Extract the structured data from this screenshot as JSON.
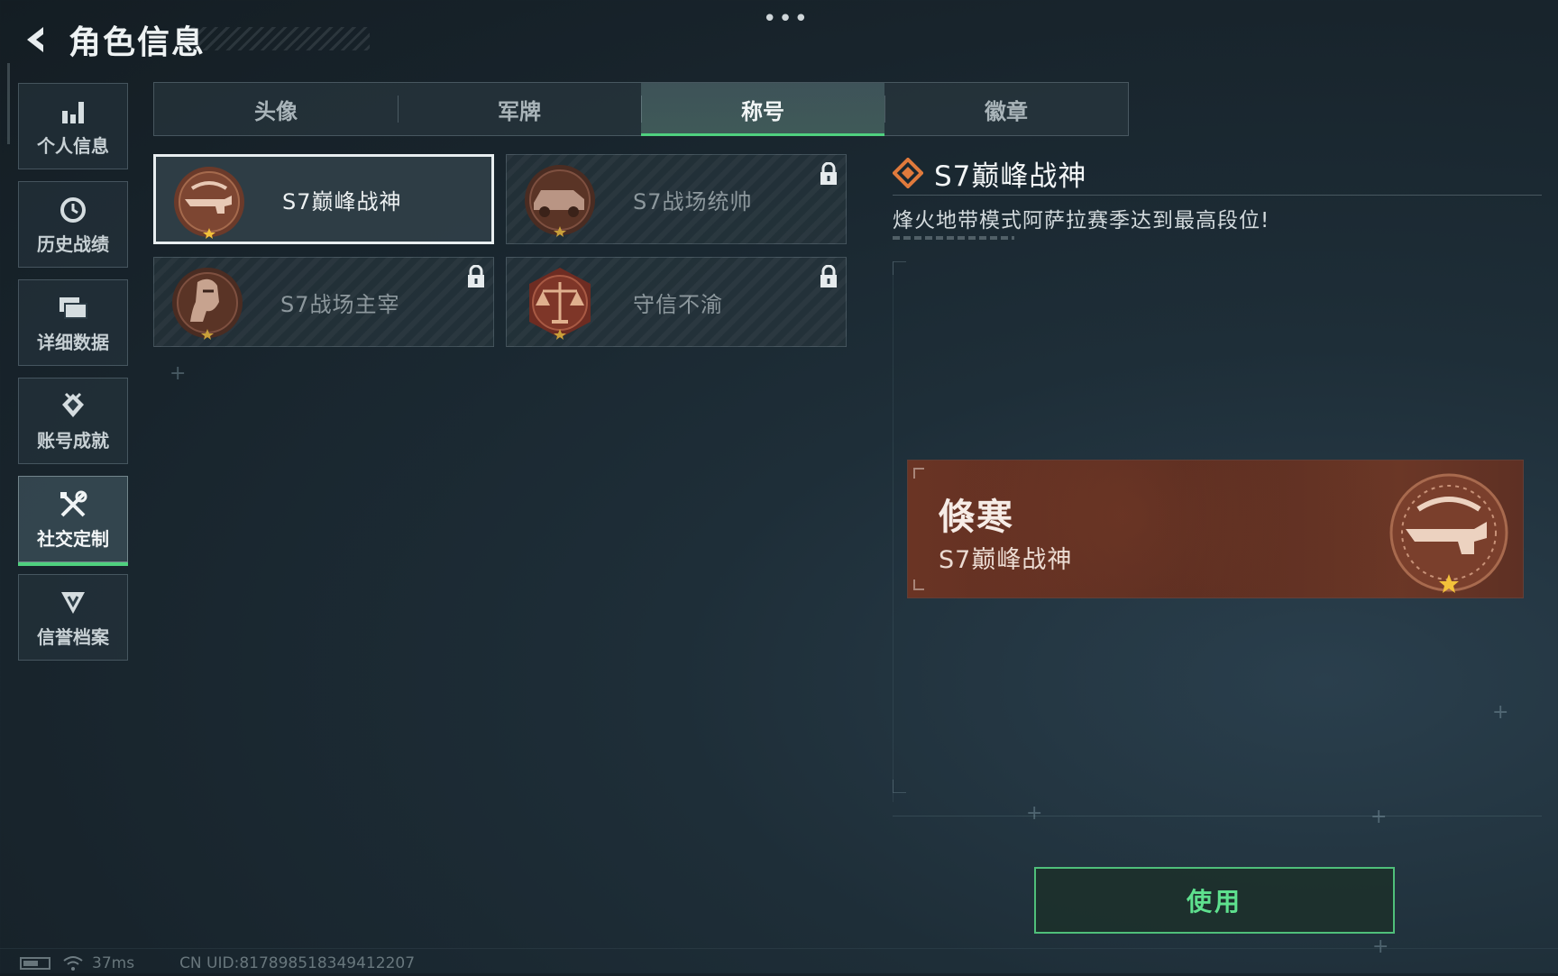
{
  "header": {
    "title": "角色信息",
    "more": "•••"
  },
  "sidebar": {
    "items": [
      {
        "label": "个人信息",
        "icon": "bar-chart-icon"
      },
      {
        "label": "历史战绩",
        "icon": "history-clock-icon"
      },
      {
        "label": "详细数据",
        "icon": "data-cards-icon"
      },
      {
        "label": "账号成就",
        "icon": "achievement-medal-icon"
      },
      {
        "label": "社交定制",
        "icon": "tools-cross-icon",
        "active": true
      },
      {
        "label": "信誉档案",
        "icon": "reputation-shield-icon"
      }
    ]
  },
  "tabs": [
    {
      "label": "头像"
    },
    {
      "label": "军牌"
    },
    {
      "label": "称号",
      "active": true
    },
    {
      "label": "徽章"
    }
  ],
  "titles": [
    {
      "label": "S7巅峰战神",
      "selected": true,
      "locked": false,
      "emblem": "rifle-emblem"
    },
    {
      "label": "S7战场统帅",
      "selected": false,
      "locked": true,
      "emblem": "vehicle-emblem"
    },
    {
      "label": "S7战场主宰",
      "selected": false,
      "locked": true,
      "emblem": "soldier-emblem"
    },
    {
      "label": "守信不渝",
      "selected": false,
      "locked": true,
      "emblem": "scales-emblem"
    }
  ],
  "detail": {
    "name": "S7巅峰战神",
    "description": "烽火地带模式阿萨拉赛季达到最高段位!"
  },
  "preview": {
    "player_name": "倏寒",
    "title": "S7巅峰战神"
  },
  "use_button": {
    "label": "使用"
  },
  "status_bar": {
    "ping": "37ms",
    "uid": "CN UID:817898518349412207"
  },
  "colors": {
    "accent_green": "#4fd07f",
    "banner_brown": "#6a3424",
    "diamond_orange": "#e07a3c"
  }
}
